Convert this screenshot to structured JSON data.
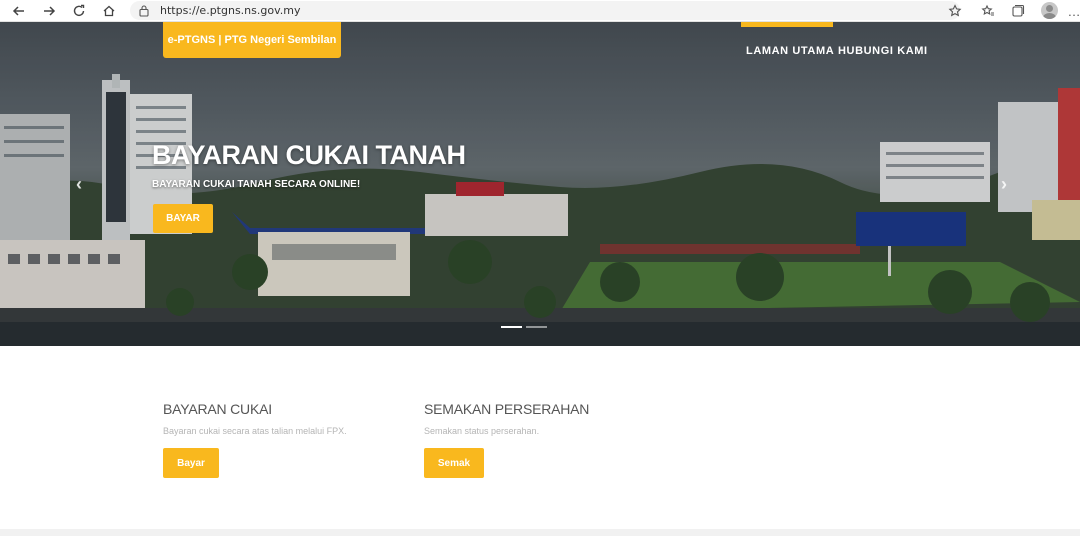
{
  "browser": {
    "url": "https://e.ptgns.ns.gov.my",
    "icons": [
      "back-arrow-icon",
      "forward-arrow-icon",
      "refresh-icon",
      "home-icon",
      "lock-icon",
      "favorite-star-icon",
      "favorites-icon",
      "collections-icon",
      "profile-avatar-icon",
      "more-icon"
    ],
    "more_glyph": "…"
  },
  "header": {
    "brand_label": "e-PTGNS | PTG Negeri Sembilan",
    "menu": [
      {
        "label": "LAMAN UTAMA",
        "active": true
      },
      {
        "label": "HUBUNGI KAMI",
        "active": false
      }
    ],
    "accent_color": "#f9b81e"
  },
  "hero": {
    "title": "BAYARAN CUKAI TANAH",
    "subtitle": "BAYARAN CUKAI TANAH SECARA ONLINE!",
    "button_label": "BAYAR",
    "prev_glyph": "‹",
    "next_glyph": "›",
    "slides_count": 2,
    "active_slide": 1
  },
  "services": [
    {
      "title": "BAYARAN CUKAI",
      "description": "Bayaran cukai secara atas talian melalui FPX.",
      "button_label": "Bayar"
    },
    {
      "title": "SEMAKAN PERSERAHAN",
      "description": "Semakan status perserahan.",
      "button_label": "Semak"
    }
  ]
}
